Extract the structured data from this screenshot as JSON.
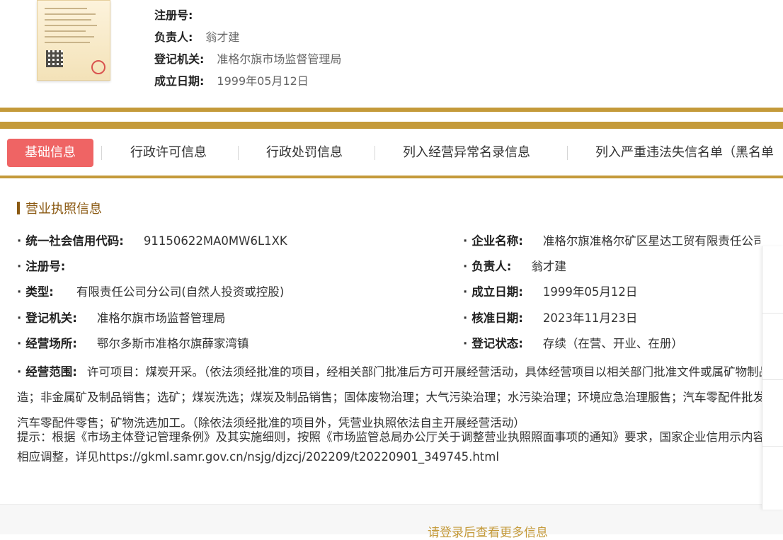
{
  "header": {
    "reg_no_label": "注册号:",
    "person_label": "负责人:",
    "person_value": "翁才建",
    "authority_label": "登记机关:",
    "authority_value": "准格尔旗市场监督管理局",
    "date_label": "成立日期:",
    "date_value": "1999年05月12日"
  },
  "tabs": [
    {
      "label": "基础信息",
      "active": true
    },
    {
      "label": "行政许可信息"
    },
    {
      "label": "行政处罚信息"
    },
    {
      "label": "列入经营异常名录信息"
    },
    {
      "label": "列入严重违法失信名单（黑名单"
    }
  ],
  "section": {
    "title": "营业执照信息"
  },
  "fields_left": [
    {
      "label": "统一社会信用代码:",
      "value": "91150622MA0MW6L1XK"
    },
    {
      "label": "注册号:",
      "value": ""
    },
    {
      "label": "类型:",
      "value": "有限责任公司分公司(自然人投资或控股)"
    },
    {
      "label": "登记机关:",
      "value": "准格尔旗市场监督管理局"
    },
    {
      "label": "经营场所:",
      "value": "鄂尔多斯市准格尔旗薛家湾镇"
    }
  ],
  "fields_right": [
    {
      "label": "企业名称:",
      "value": "准格尔旗准格尔矿区星达工贸有限责任公司"
    },
    {
      "label": "负责人:",
      "value": "翁才建"
    },
    {
      "label": "成立日期:",
      "value": "1999年05月12日"
    },
    {
      "label": "核准日期:",
      "value": "2023年11月23日"
    },
    {
      "label": "登记状态:",
      "value": "存续（在营、开业、在册）"
    }
  ],
  "scope": {
    "label": "经营范围:",
    "value": "许可项目：煤炭开采。（依法须经批准的项目，经相关部门批准后方可开展经营活动，具体经营项目以相关部门批准文件或属矿物制品制造；非金属矿及制品销售；选矿；煤炭洗选；煤炭及制品销售；固体废物治理；大气污染治理；水污染治理；环境应急治理服售；汽车零配件批发；汽车零配件零售；矿物洗选加工。（除依法须经批准的项目外，凭营业执照依法自主开展经营活动）"
  },
  "tip": {
    "text": "提示：根据《市场主体登记管理条例》及其实施细则，按照《市场监管总局办公厅关于调整营业执照照面事项的通知》要求，国家企业信用示内容作相应调整，详见https://gkml.samr.gov.cn/nsjg/djzcj/202209/t20220901_349745.html"
  },
  "footer": {
    "login_text": "请登录后查看更多信息"
  },
  "colors": {
    "gold": "#c49a3a",
    "active_tab": "#ef6464",
    "section_brown": "#8b5a13"
  }
}
